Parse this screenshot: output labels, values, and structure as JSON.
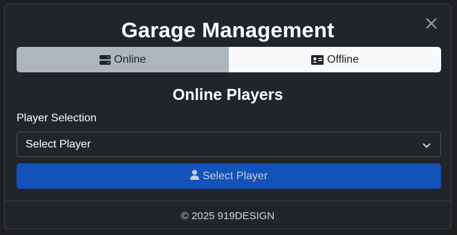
{
  "modal": {
    "title": "Garage Management",
    "close_icon": "close-icon"
  },
  "tabs": [
    {
      "label": "Online",
      "icon": "server-icon",
      "active": true
    },
    {
      "label": "Offline",
      "icon": "id-card-icon",
      "active": false
    }
  ],
  "section": {
    "title": "Online Players"
  },
  "player_selection": {
    "label": "Player Selection",
    "selected_value": "Select Player",
    "icon": "chevron-down-icon"
  },
  "select_button": {
    "label": "Select Player",
    "icon": "user-icon"
  },
  "footer": {
    "text": "© 2025 919DESIGN"
  },
  "colors": {
    "background": "#212529",
    "tab_online": "#adb5bd",
    "tab_offline": "#f8f9fa",
    "button_primary": "#1352b8"
  }
}
